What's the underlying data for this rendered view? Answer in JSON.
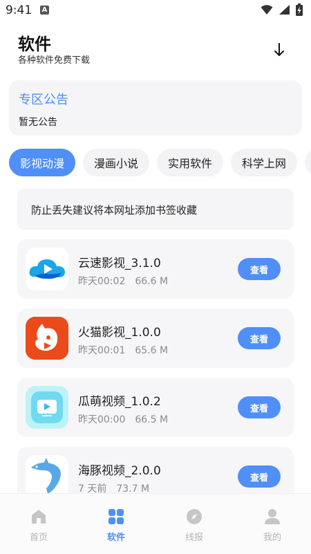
{
  "status": {
    "time": "9:41",
    "notification_letter": "A"
  },
  "header": {
    "title": "软件",
    "subtitle": "各种软件免费下载",
    "download_icon": "download-arrow-icon"
  },
  "notice": {
    "title": "专区公告",
    "text": "暂无公告"
  },
  "tabs": [
    {
      "label": "影视动漫",
      "active": true
    },
    {
      "label": "漫画小说",
      "active": false
    },
    {
      "label": "实用软件",
      "active": false
    },
    {
      "label": "科学上网",
      "active": false
    }
  ],
  "tip": {
    "text": "防止丢失建议将本网址添加书签收藏"
  },
  "apps": [
    {
      "name": "云速影视_3.1.0",
      "time": "昨天00:02",
      "size": "66.6 M",
      "button": "查看",
      "icon": "cloud-play-icon"
    },
    {
      "name": "火猫影视_1.0.0",
      "time": "昨天00:01",
      "size": "65.6 M",
      "button": "查看",
      "icon": "fire-cat-icon"
    },
    {
      "name": "瓜萌视频_1.0.2",
      "time": "昨天00:00",
      "size": "66.5 M",
      "button": "查看",
      "icon": "tv-play-icon"
    },
    {
      "name": "海豚视频_2.0.0",
      "time": "7 天前",
      "size": "73.7 M",
      "button": "查看",
      "icon": "dolphin-icon"
    }
  ],
  "nav": [
    {
      "label": "首页",
      "icon": "home-icon",
      "active": false
    },
    {
      "label": "软件",
      "icon": "grid-icon",
      "active": true
    },
    {
      "label": "线报",
      "icon": "compass-icon",
      "active": false
    },
    {
      "label": "我的",
      "icon": "user-icon",
      "active": false
    }
  ],
  "colors": {
    "accent": "#4f8ff7",
    "card_bg": "#f5f5f7",
    "nav_inactive": "#b4b4b4"
  }
}
